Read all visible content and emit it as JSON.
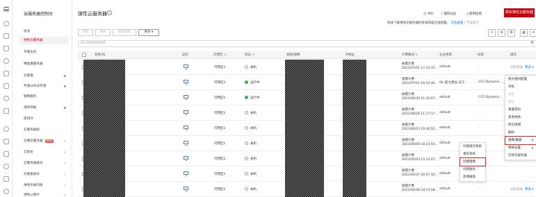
{
  "nav": {
    "title": "云服务器控制台",
    "items": [
      {
        "label": "总览"
      },
      {
        "label": "弹性云服务器",
        "active": true
      },
      {
        "label": "专属主机"
      },
      {
        "label": "裸金属服务器"
      },
      {
        "label": "云硬盘",
        "arrow": true
      },
      {
        "label": "专属分布式存储",
        "arrow": true
      },
      {
        "label": "镜像服务"
      },
      {
        "label": "弹性伸缩",
        "arrow": true
      },
      {
        "label": "密钥对"
      },
      {
        "label": "云服务器组"
      },
      {
        "label": "云耀云服务器",
        "badge": "NEW"
      },
      {
        "label": "云备份"
      },
      {
        "label": "云服务器备份"
      },
      {
        "label": "云硬盘备份"
      },
      {
        "label": "弹性负载均衡"
      },
      {
        "label": "弹性公网IP"
      }
    ]
  },
  "header": {
    "title": "弹性云服务器",
    "help": "?",
    "rate": "评价",
    "latest": "最新动态",
    "guide": "使用指南",
    "buy": "购买弹性云服务器"
  },
  "notice": {
    "text": "快速了解弹性云服务器的登录和安全组配置。",
    "link": "点击查看",
    "dismiss": "不再提示"
  },
  "toolbar": {
    "buttons": [
      "开机",
      "关机",
      "重置密码",
      "更多"
    ],
    "search_placeholder": "默认按照名称搜索"
  },
  "table": {
    "headers": [
      "名称/ID",
      "监控",
      "可用区",
      "状态",
      "规格/镜像",
      "IP地址",
      "计费模式",
      "企业项目",
      "标签",
      "操作"
    ],
    "rows": [
      {
        "zone": "可用区1",
        "status": "关机",
        "running": false,
        "billing": "按需计费",
        "created": "2021/07/01 17:15:33...",
        "project": "default",
        "tag": "--",
        "ops_dim": "远程登录",
        "ops_more": "更多"
      },
      {
        "zone": "可用区3",
        "status": "运行中",
        "running": true,
        "billing": "按需计费",
        "created": "2021/07/01 16:52:46...",
        "project": "00_能力建设-员工...",
        "tag": "CCE-Dynamic..."
      },
      {
        "zone": "可用区1",
        "status": "运行中",
        "running": true,
        "billing": "按需计费",
        "created": "2021/06/30 11:32:07...",
        "project": "default",
        "tag": "CCE-Dynamic..."
      },
      {
        "zone": "可用区1",
        "status": "关机",
        "running": false,
        "billing": "按需计费",
        "created": "2021/06/26 11:17:17...",
        "project": "default",
        "tag": "--"
      },
      {
        "zone": "可用区1",
        "status": "关机",
        "running": false,
        "billing": "按需计费",
        "created": "2021/06/25 19:30:52...",
        "project": "default",
        "tag": "--"
      },
      {
        "zone": "可用区1",
        "status": "关机",
        "running": false,
        "billing": "按需计费",
        "created": "2021/06/08 18:23:50...",
        "project": "default",
        "tag": "--"
      },
      {
        "zone": "可用区1",
        "status": "关机",
        "running": false,
        "billing": "按需计费",
        "created": "2021/05/03 15:12:07...",
        "project": "default",
        "tag": "--"
      },
      {
        "zone": "可用区1",
        "status": "关机",
        "running": false,
        "billing": "按需计费",
        "created": "2021/04/27 20:07:10...",
        "project": "default",
        "tag": "--"
      },
      {
        "zone": "可用区2",
        "status": "关机",
        "running": false,
        "billing": "按需计费",
        "created": "2021/04/26 18:13:58...",
        "project": "default",
        "tag": "--",
        "ops_dim": "远程登录",
        "ops_more": "更多"
      }
    ]
  },
  "more_menu": {
    "items": [
      {
        "label": "购买相同配置"
      },
      {
        "label": "开机"
      },
      {
        "label": "关机",
        "disabled": true
      },
      {
        "label": "重启",
        "disabled": true
      },
      {
        "label": "重置密码"
      },
      {
        "label": "变更规格"
      },
      {
        "label": "转包周期"
      },
      {
        "label": "删除"
      },
      {
        "label": "镜像/磁盘",
        "arrow": true,
        "boxed": true
      },
      {
        "label": "网络设置",
        "arrow": true
      },
      {
        "label": "迁移云服务器"
      }
    ]
  },
  "sub_menu": {
    "items": [
      {
        "label": "切换操作系统"
      },
      {
        "label": "重装系统"
      },
      {
        "label": "创建镜像",
        "boxed": true
      },
      {
        "label": "创建备份"
      },
      {
        "label": "新增磁盘"
      }
    ]
  }
}
